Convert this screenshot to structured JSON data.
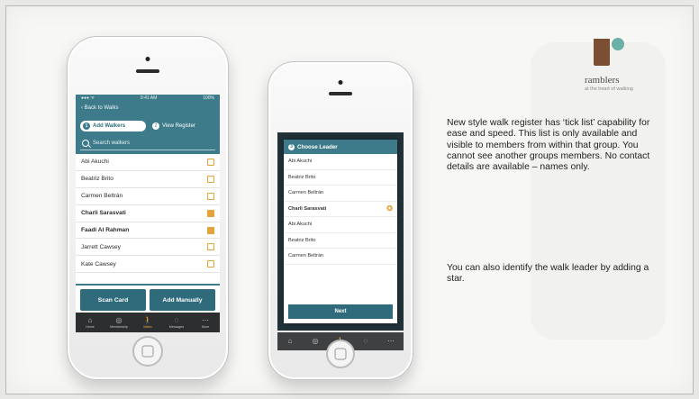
{
  "brand": {
    "name": "ramblers",
    "tagline": "at the heart of walking",
    "colors": {
      "teal": "#3d7b8a",
      "brown": "#7a4f32",
      "mint": "#6ab0a4",
      "accent": "#e4a33b"
    }
  },
  "phone1": {
    "status": {
      "left": "●●● ᯤ",
      "time": "9:41 AM",
      "right": "100%"
    },
    "back_label": "Back to Walks",
    "tabs": [
      {
        "num": "1",
        "label": "Add Walkers",
        "active": true
      },
      {
        "num": "2",
        "label": "View Register",
        "active": false
      }
    ],
    "search_placeholder": "Search walkers",
    "walkers": [
      {
        "name": "Abi Akuchi",
        "checked": false
      },
      {
        "name": "Beatriz Brito",
        "checked": false
      },
      {
        "name": "Carmen Beltrán",
        "checked": false
      },
      {
        "name": "Charli Sarasvati",
        "checked": true
      },
      {
        "name": "Faadi Al Rahman",
        "checked": true
      },
      {
        "name": "Jarrett Cawsey",
        "checked": false
      },
      {
        "name": "Kate Cawsey",
        "checked": false
      }
    ],
    "scan_label": "Scan Card",
    "add_label": "Add Manually",
    "tabbar": [
      {
        "icon": "home-icon",
        "glyph": "⌂",
        "label": "Home"
      },
      {
        "icon": "membership-icon",
        "glyph": "◎",
        "label": "Membership"
      },
      {
        "icon": "walker-icon",
        "glyph": "🚶",
        "label": "Walks"
      },
      {
        "icon": "messages-icon",
        "glyph": "◌",
        "label": "Messages"
      },
      {
        "icon": "more-icon",
        "glyph": "⋯",
        "label": "More"
      }
    ]
  },
  "phone2": {
    "modal_num": "3",
    "modal_title": "Choose Leader",
    "members": [
      {
        "name": "Abi Akuchi",
        "leader": false
      },
      {
        "name": "Beatriz Brito",
        "leader": false
      },
      {
        "name": "Carmen Beltrán",
        "leader": false
      },
      {
        "name": "Charli Sarasvati",
        "leader": true
      },
      {
        "name": "Abi Akuchi",
        "leader": false
      },
      {
        "name": "Beatriz Brito",
        "leader": false
      },
      {
        "name": "Carmen Beltrán",
        "leader": false
      }
    ],
    "next_label": "Next"
  },
  "captions": {
    "first": "New style walk register has ‘tick list’ capability for ease and speed.  This list is only available and visible to members from within that group. You cannot see another groups members.  No contact details are available – names only.",
    "second": "You can also identify the walk leader by adding a star."
  }
}
